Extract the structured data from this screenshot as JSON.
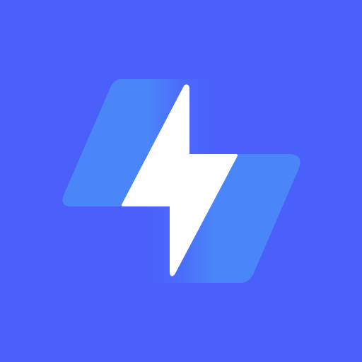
{
  "icon": {
    "name": "lightning-bolt-icon",
    "colors": {
      "background": "#4b60fb",
      "panel_light": "#4a88f8",
      "panel_dark": "#4b60fb",
      "bolt": "#ffffff"
    }
  }
}
